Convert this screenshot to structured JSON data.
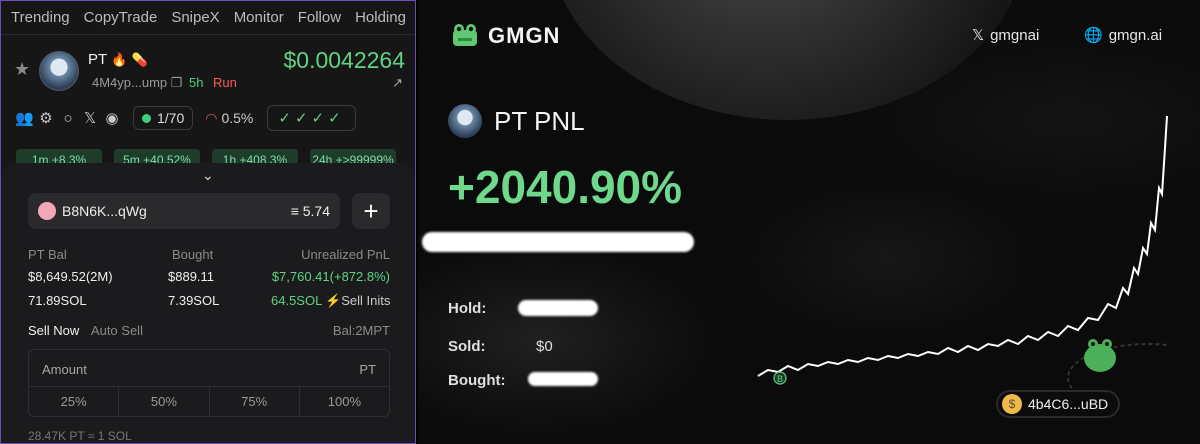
{
  "nav": [
    "Trending",
    "CopyTrade",
    "SnipeX",
    "Monitor",
    "Follow",
    "Holding"
  ],
  "token": {
    "name": "PT",
    "address": "4M4yp...ump",
    "age": "5h",
    "status": "Run",
    "price": "$0.0042264"
  },
  "stats": {
    "holders": "1/70",
    "top10_pct": "0.5%",
    "checks": "✓✓✓✓"
  },
  "timeframes": [
    "1m +8.3%",
    "5m +40.52%",
    "1h +408.3%",
    "24h +>99999%"
  ],
  "wallet": {
    "name": "B8N6K...qWg",
    "balance": "5.74"
  },
  "holdings": {
    "headers": [
      "PT Bal",
      "Bought",
      "Unrealized PnL"
    ],
    "row1": [
      "$8,649.52(2M)",
      "$889.11",
      "$7,760.41(+872.8%)"
    ],
    "row2": [
      "71.89SOL",
      "7.39SOL",
      "64.5SOL"
    ],
    "sell_inits": "Sell Inits"
  },
  "sell": {
    "tab_active": "Sell Now",
    "tab_inactive": "Auto Sell",
    "balance": "Bal:2MPT",
    "amount_label": "Amount",
    "amount_unit": "PT",
    "percents": [
      "25%",
      "50%",
      "75%",
      "100%"
    ],
    "rate": "28.47K PT ≈ 1 SOL"
  },
  "card": {
    "brand": "GMGN",
    "twitter": "gmgnai",
    "site": "gmgn.ai",
    "title": "PT PNL",
    "pnl": "+2040.90%",
    "hold_label": "Hold:",
    "sold_label": "Sold:",
    "sold_value": "$0",
    "bought_label": "Bought:",
    "wallet_tag": "4b4C6...uBD",
    "buy_marker": "B"
  },
  "colors": {
    "green": "#5fd382",
    "red": "#ff5b5b",
    "accent_border": "#6b4fb6"
  }
}
